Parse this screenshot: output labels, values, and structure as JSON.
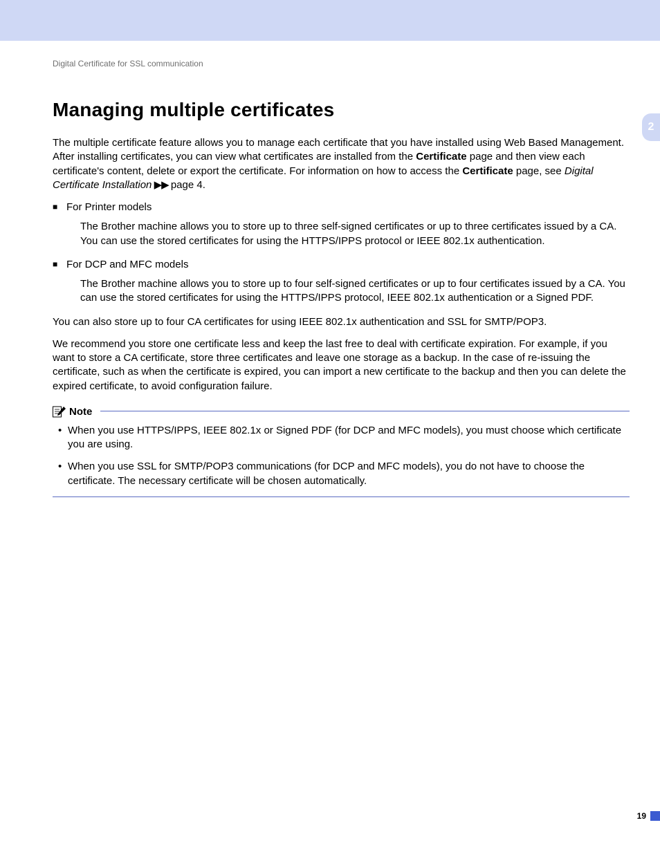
{
  "running_head": "Digital Certificate for SSL communication",
  "title": "Managing multiple certificates",
  "intro": {
    "part1": "The multiple certificate feature allows you to manage each certificate that you have installed using Web Based Management. After installing certificates, you can view what certificates are installed from the ",
    "bold1": "Certificate",
    "part2": " page and then view each certificate's content, delete or export the certificate. For information on how to access the ",
    "bold2": "Certificate",
    "part3": " page, see ",
    "italic1": "Digital Certificate Installation",
    "arrows": " ▶▶ ",
    "part4": "page 4."
  },
  "bullets": {
    "b1_head": "For Printer models",
    "b1_body": "The Brother machine allows you to store up to three self-signed certificates or up to three certificates issued by a CA. You can use the stored certificates for using the HTTPS/IPPS protocol or IEEE 802.1x authentication.",
    "b2_head": "For DCP and MFC models",
    "b2_body": "The Brother machine allows you to store up to four self-signed certificates or up to four certificates issued by a CA. You can use the stored certificates for using the HTTPS/IPPS protocol, IEEE 802.1x authentication or a Signed PDF."
  },
  "para_ca": "You can also store up to four CA certificates for using IEEE 802.1x authentication and SSL for SMTP/POP3.",
  "para_rec": "We recommend you store one certificate less and keep the last free to deal with certificate expiration. For example, if you want to store a CA certificate, store three certificates and leave one storage as a backup. In the case of re-issuing the certificate, such as when the certificate is expired, you can import a new certificate to the backup and then you can delete the expired certificate, to avoid configuration failure.",
  "note": {
    "label": "Note",
    "items": [
      "When you use HTTPS/IPPS, IEEE 802.1x or Signed PDF (for DCP and MFC models), you must choose which certificate you are using.",
      "When you use SSL for SMTP/POP3 communications (for DCP and MFC models), you do not have to choose the certificate. The necessary certificate will be chosen automatically."
    ]
  },
  "side_tab": "2",
  "page_number": "19"
}
